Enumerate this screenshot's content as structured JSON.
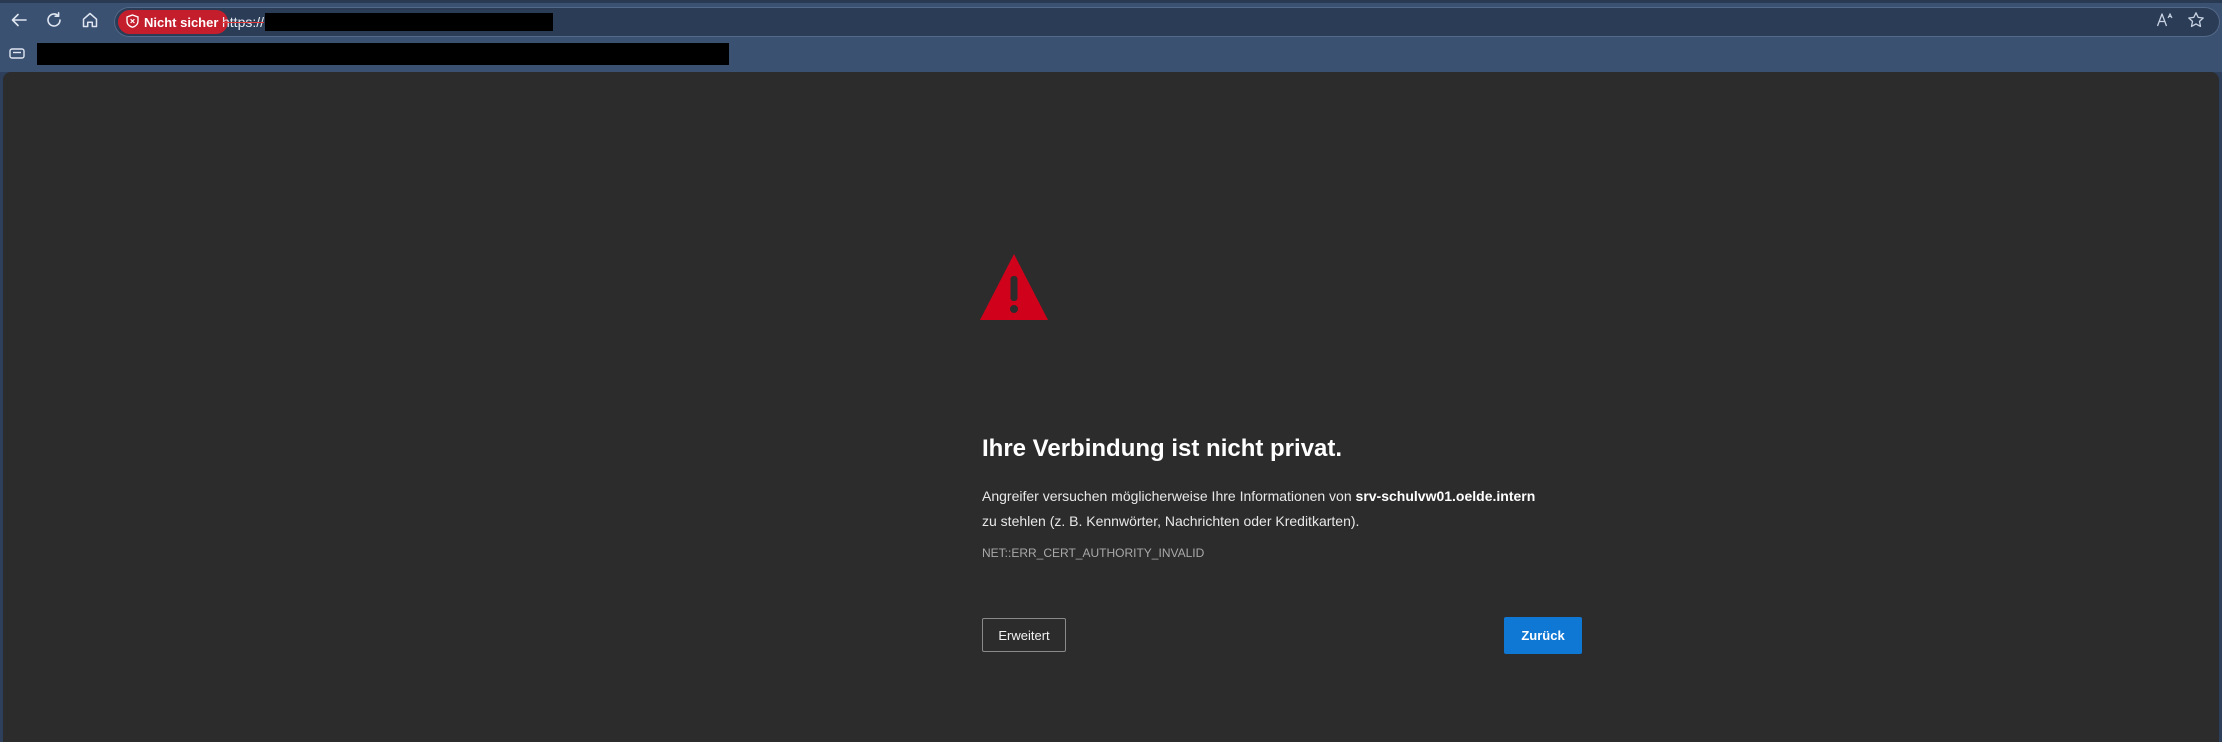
{
  "toolbar": {
    "back_icon": "arrow-left-icon",
    "refresh_icon": "refresh-icon",
    "home_icon": "home-icon"
  },
  "address_bar": {
    "security_label": "Nicht sicher",
    "security_icon": "shield-warning-icon",
    "url_scheme": "https://",
    "read_aloud_icon": "read-aloud-icon",
    "favorite_icon": "star-icon"
  },
  "favorites_bar": {
    "icon": "folder-icon"
  },
  "error_page": {
    "warning_icon": "warning-triangle-icon",
    "title": "Ihre Verbindung ist nicht privat.",
    "description_before": "Angreifer versuchen möglicherweise Ihre Informationen von ",
    "host": "srv-schulvw01.oelde.intern",
    "description_after": " zu stehlen (z. B. Kennwörter, Nachrichten oder Kreditkarten).",
    "error_code": "NET::ERR_CERT_AUTHORITY_INVALID",
    "advanced_label": "Erweitert",
    "back_label": "Zurück"
  },
  "colors": {
    "security_chip": "#c41e2d",
    "warning_icon": "#d0021b",
    "back_button": "#0f78d4",
    "page_background": "#2c2c2c",
    "browser_frame": "#3b5172"
  }
}
